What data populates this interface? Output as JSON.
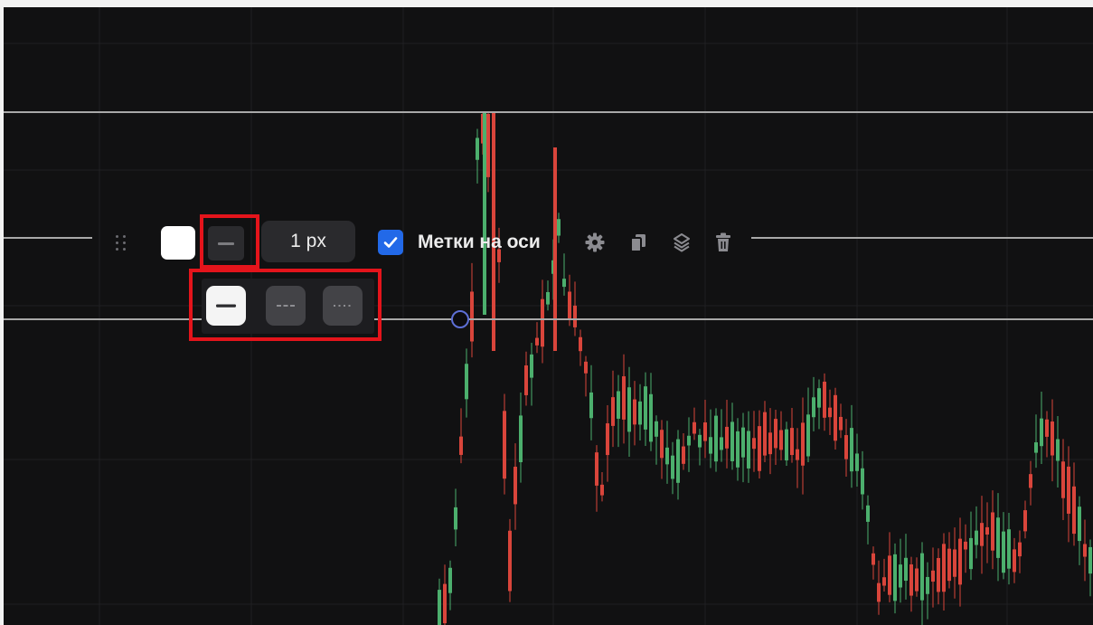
{
  "toolbar": {
    "width_label": "1 px",
    "axis_labels_text": "Метки на оси",
    "axis_labels_checked": true,
    "line_color": "#ffffff",
    "icons": [
      "drag-handle-icon",
      "gear-icon",
      "copy-icon",
      "layers-icon",
      "trash-icon"
    ]
  },
  "line_style_menu": {
    "options": [
      "solid",
      "dashed",
      "dotted"
    ],
    "selected": "solid"
  },
  "colors": {
    "background": "#111112",
    "bull": "#4caf6d",
    "bear": "#d9453b",
    "accent": "#2269e8",
    "highlight": "#e4141b"
  }
}
